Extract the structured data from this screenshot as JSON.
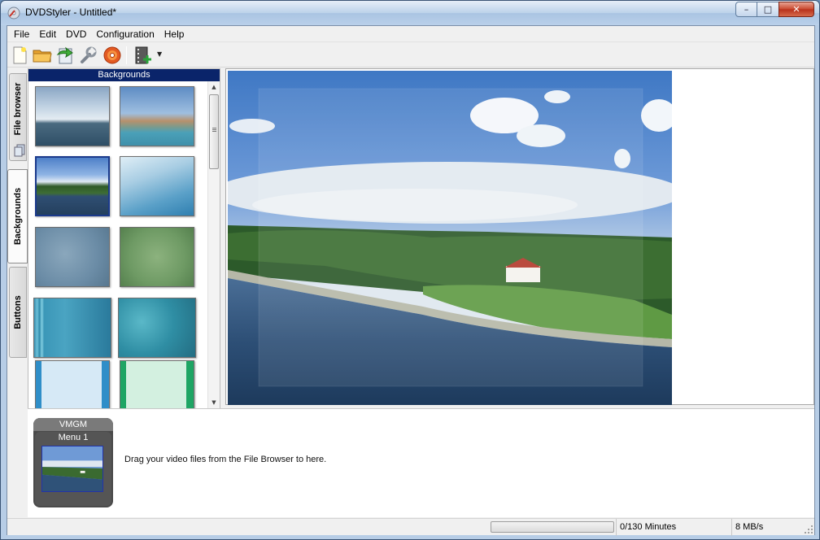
{
  "window": {
    "title": "DVDStyler - Untitled*",
    "controls": {
      "minimize": "–",
      "maximize": "□",
      "close": "✕"
    }
  },
  "menubar": {
    "items": [
      {
        "label": "File"
      },
      {
        "label": "Edit"
      },
      {
        "label": "DVD"
      },
      {
        "label": "Configuration"
      },
      {
        "label": "Help"
      }
    ]
  },
  "toolbar": {
    "buttons": [
      {
        "icon": "new-file-icon"
      },
      {
        "icon": "open-folder-icon"
      },
      {
        "icon": "save-icon"
      },
      {
        "icon": "settings-wrench-icon"
      },
      {
        "icon": "burn-disc-icon"
      },
      {
        "icon": "add-file-icon"
      }
    ]
  },
  "sidebar": {
    "tabs": [
      {
        "label": "File browser",
        "active": false
      },
      {
        "label": "Backgrounds",
        "active": true
      },
      {
        "label": "Buttons",
        "active": false
      }
    ]
  },
  "backgrounds_panel": {
    "header": "Backgrounds",
    "items": [
      {
        "name": "bg-sea-clouds"
      },
      {
        "name": "bg-ship-coast"
      },
      {
        "name": "bg-river-house",
        "selected": true
      },
      {
        "name": "bg-blue-gradient-rays"
      },
      {
        "name": "bg-blue-blur"
      },
      {
        "name": "bg-green-blur"
      },
      {
        "name": "bg-teal-stripes"
      },
      {
        "name": "bg-teal-texture"
      },
      {
        "name": "bg-light-blue-frame"
      },
      {
        "name": "bg-light-green-frame"
      }
    ]
  },
  "titleset": {
    "vmgm_label": "VMGM",
    "menu_label": "Menu 1",
    "drag_hint": "Drag your video files from the File Browser to here."
  },
  "statusbar": {
    "duration": "0/130 Minutes",
    "bitrate": "8 MB/s",
    "progress": 0
  }
}
